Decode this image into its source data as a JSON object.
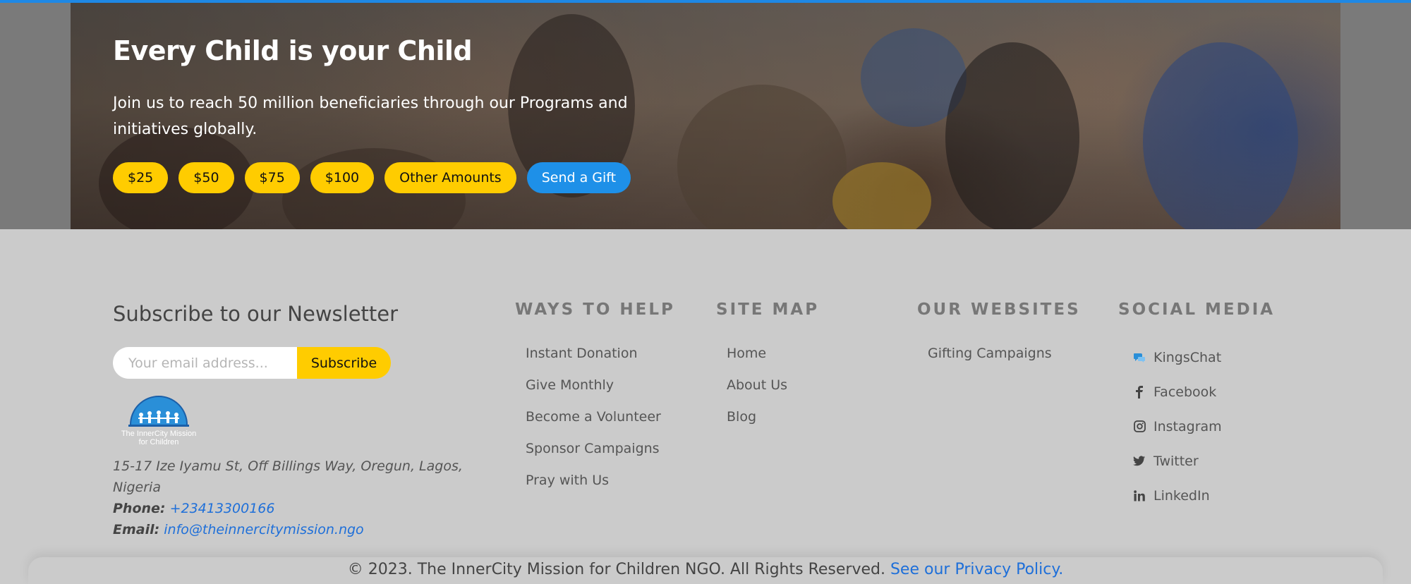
{
  "hero": {
    "title": "Every Child is your Child",
    "text": "Join us to reach 50 million beneficiaries through our Programs and initiatives globally.",
    "amounts": [
      "$25",
      "$50",
      "$75",
      "$100",
      "Other Amounts"
    ],
    "gift_label": "Send a Gift"
  },
  "newsletter": {
    "title": "Subscribe to our Newsletter",
    "placeholder": "Your email address...",
    "button": "Subscribe"
  },
  "logo": {
    "line1": "The InnerCity Mission",
    "line2": "for Children"
  },
  "contact": {
    "address": "15-17 Ize Iyamu St, Off Billings Way, Oregun, Lagos, Nigeria",
    "phone_label": "Phone:",
    "phone": "+23413300166",
    "email_label": "Email:",
    "email": "info@theinnercitymission.ngo"
  },
  "columns": {
    "ways": {
      "heading": "WAYS TO HELP",
      "items": [
        "Instant Donation",
        "Give Monthly",
        "Become a Volunteer",
        "Sponsor Campaigns",
        "Pray with Us"
      ]
    },
    "sitemap": {
      "heading": "SITE MAP",
      "items": [
        "Home",
        "About Us",
        "Blog"
      ]
    },
    "websites": {
      "heading": "OUR WEBSITES",
      "items": [
        "Gifting Campaigns"
      ]
    },
    "social": {
      "heading": "SOCIAL MEDIA",
      "items": [
        {
          "label": "KingsChat",
          "icon": "kingschat-icon"
        },
        {
          "label": "Facebook",
          "icon": "facebook-icon"
        },
        {
          "label": "Instagram",
          "icon": "instagram-icon"
        },
        {
          "label": "Twitter",
          "icon": "twitter-icon"
        },
        {
          "label": "LinkedIn",
          "icon": "linkedin-icon"
        }
      ]
    }
  },
  "footer": {
    "copyright": "© 2023. The InnerCity Mission for Children NGO. All Rights Reserved.",
    "privacy": "See our Privacy Policy."
  },
  "colors": {
    "accent_yellow": "#ffcc00",
    "accent_blue": "#1e90e8",
    "link": "#1e6fd9",
    "footer_bg": "#cbcbcb"
  }
}
